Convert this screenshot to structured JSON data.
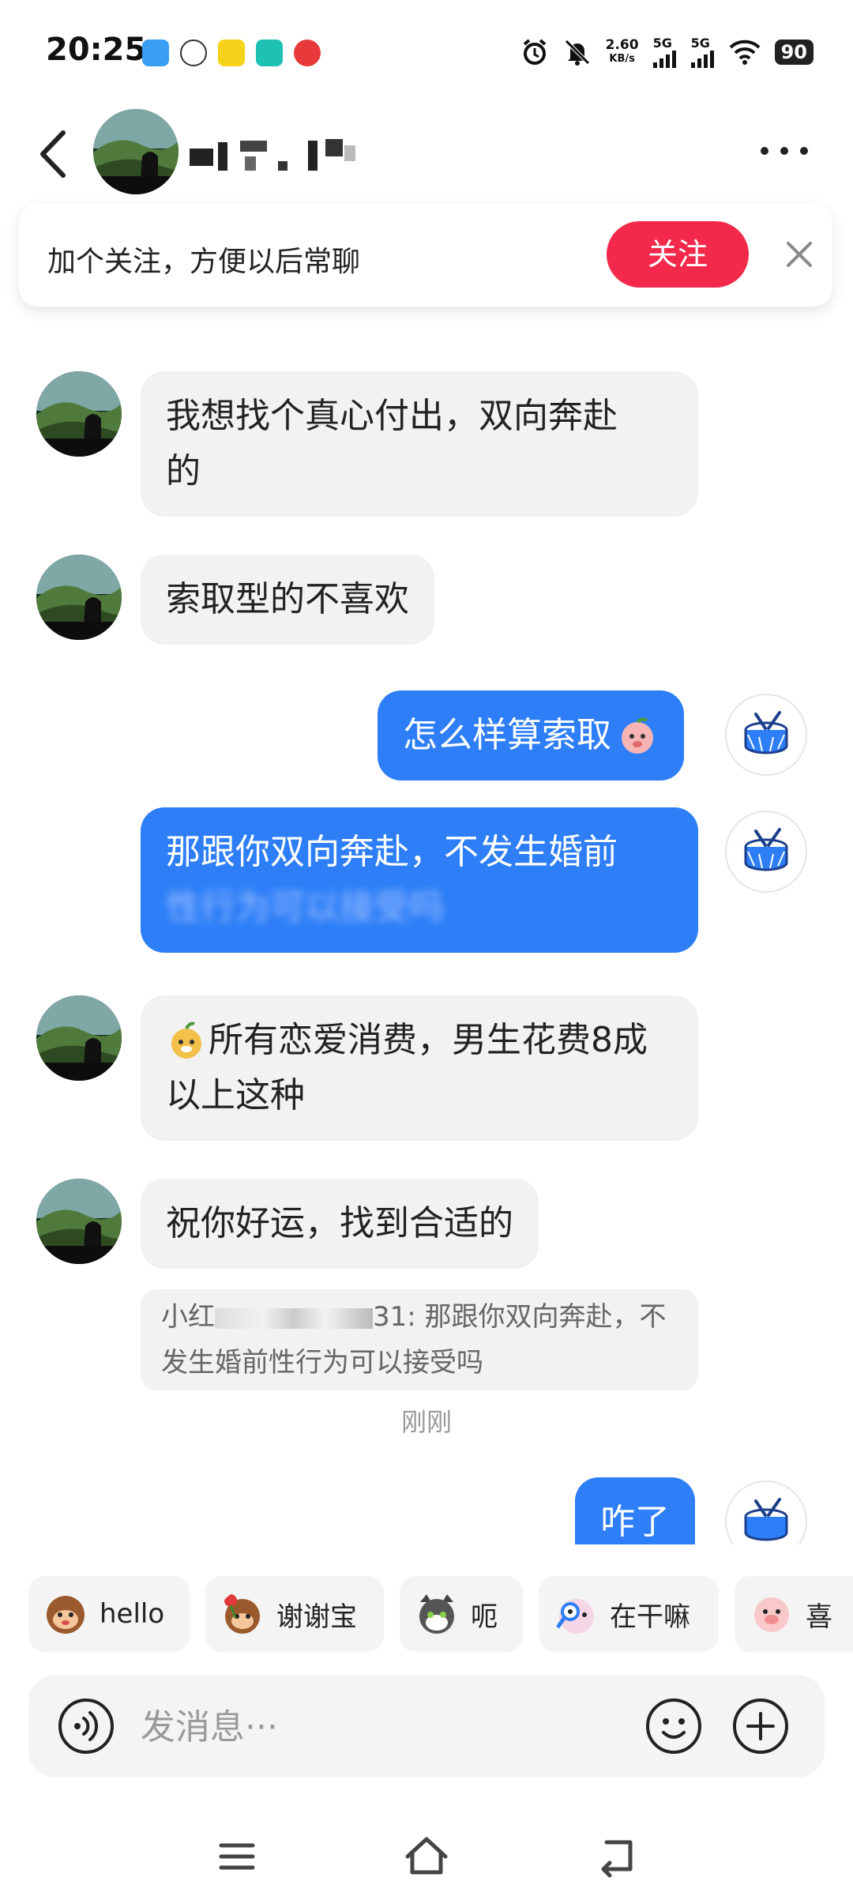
{
  "status_bar": {
    "time": "20:25",
    "net_speed_value": "2.60",
    "net_speed_unit": "KB/s",
    "signal1_label": "5G",
    "signal2_label": "5G",
    "battery": "90"
  },
  "header": {
    "back_icon": "back-chevron-icon",
    "more_icon": "more-dots-icon"
  },
  "follow_banner": {
    "text": "加个关注，方便以后常聊",
    "follow_label": "关注",
    "close_icon": "close-icon",
    "accent": "#f2294a"
  },
  "messages": [
    {
      "side": "in",
      "line1": "我想找个真心付出，双向奔赴",
      "line2": "的"
    },
    {
      "side": "in",
      "text": "索取型的不喜欢"
    },
    {
      "side": "out",
      "text": "怎么样算索取"
    },
    {
      "side": "out",
      "line1": "那跟你双向奔赴，不发生婚前",
      "line2_obscured": "性行为可以接受吗"
    },
    {
      "side": "in",
      "line1": "所有恋爱消费，男生花费8成",
      "line2": "以上这种"
    },
    {
      "side": "in",
      "text": "祝你好运，找到合适的",
      "quote_prefix": "小红",
      "quote_suffix": "31: 那跟你双向奔赴，不",
      "quote_line2": "发生婚前性行为可以接受吗"
    },
    {
      "side": "out",
      "text": "咋了"
    }
  ],
  "timestamp": "刚刚",
  "quick_replies": [
    {
      "label": "hello",
      "icon": "monkey-wave-icon"
    },
    {
      "label": "谢谢宝",
      "icon": "monkey-rose-icon"
    },
    {
      "label": "呃",
      "icon": "cat-icon"
    },
    {
      "label": "在干嘛",
      "icon": "peeking-magnifier-icon"
    },
    {
      "label": "喜",
      "icon": "pig-icon"
    }
  ],
  "input": {
    "placeholder": "发消息···",
    "voice_icon": "voice-icon",
    "emoji_icon": "emoji-icon",
    "add_icon": "add-icon"
  },
  "colors": {
    "outgoing_bubble": "#2d7ef7",
    "incoming_bubble": "#f2f2f2"
  }
}
